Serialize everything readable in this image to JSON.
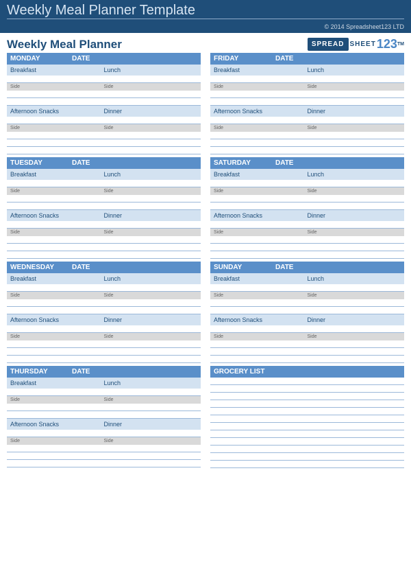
{
  "banner": {
    "title": "Weekly Meal Planner Template",
    "copyright": "© 2014 Spreadsheet123 LTD"
  },
  "header": {
    "title": "Weekly Meal Planner",
    "logo": {
      "word1": "SPREAD",
      "word2": "SHEET",
      "num": "123",
      "tm": "TM"
    }
  },
  "labels": {
    "date": "DATE",
    "breakfast": "Breakfast",
    "lunch": "Lunch",
    "snacks": "Afternoon Snacks",
    "dinner": "Dinner",
    "side": "Side",
    "grocery": "GROCERY LIST"
  },
  "days": [
    "MONDAY",
    "TUESDAY",
    "WEDNESDAY",
    "THURSDAY",
    "FRIDAY",
    "SATURDAY",
    "SUNDAY"
  ]
}
